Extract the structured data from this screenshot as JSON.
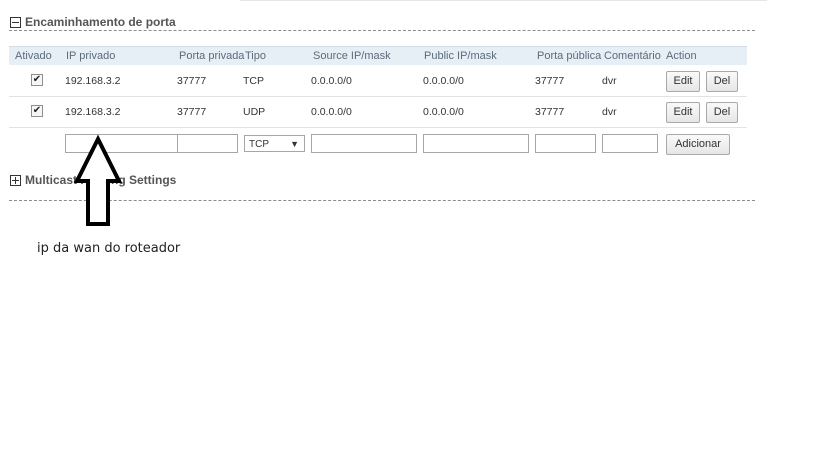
{
  "port_forwarding": {
    "title": "Encaminhamento de porta",
    "columns": [
      "Ativado",
      "IP privado",
      "Porta privada",
      "Tipo",
      "Source IP/mask",
      "Public IP/mask",
      "Porta pública",
      "Comentário",
      "Action"
    ],
    "rows": [
      {
        "enabled": true,
        "private_ip": "192.168.3.2",
        "private_port": "37777",
        "type": "TCP",
        "source_ip": "0.0.0.0/0",
        "public_ip": "0.0.0.0/0",
        "public_port": "37777",
        "comment": "dvr",
        "edit_label": "Edit",
        "del_label": "Del"
      },
      {
        "enabled": true,
        "private_ip": "192.168.3.2",
        "private_port": "37777",
        "type": "UDP",
        "source_ip": "0.0.0.0/0",
        "public_ip": "0.0.0.0/0",
        "public_port": "37777",
        "comment": "dvr",
        "edit_label": "Edit",
        "del_label": "Del"
      }
    ],
    "new_row": {
      "type_selected": "TCP",
      "add_label": "Adicionar"
    }
  },
  "multicast": {
    "title": "Multicast Routing Settings"
  },
  "annotation": {
    "text": "ip da wan do roteador",
    "arrow": "up-arrow-icon"
  }
}
